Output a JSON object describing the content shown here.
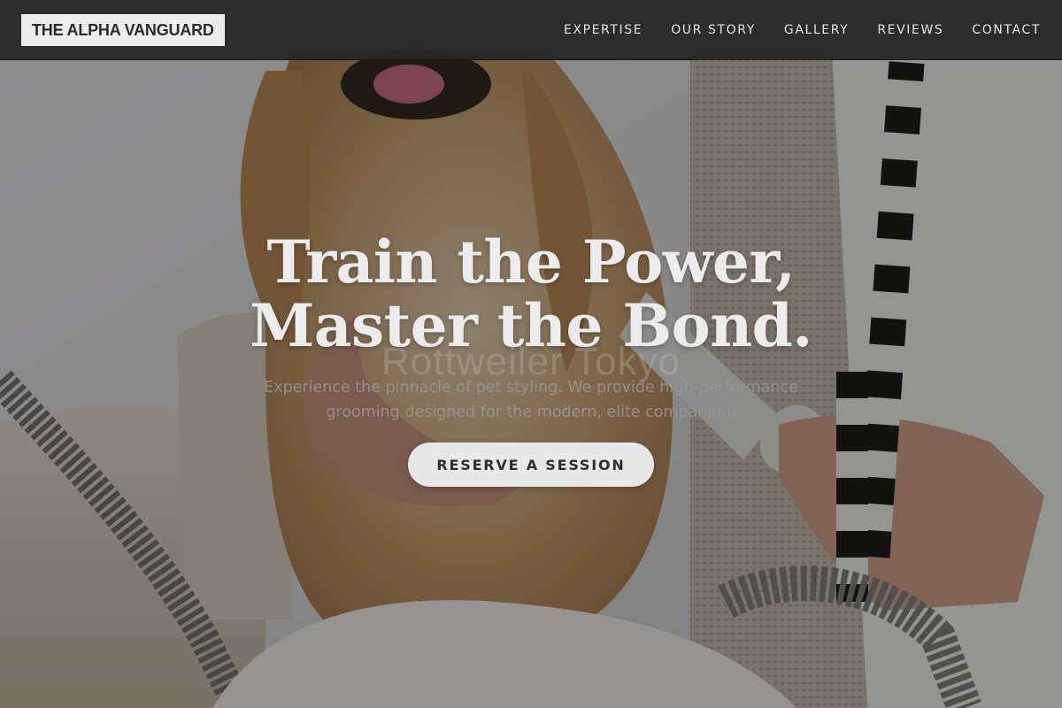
{
  "nav": {
    "brand": "THE ALPHA VANGUARD",
    "links": [
      {
        "label": "EXPERTISE"
      },
      {
        "label": "OUR STORY"
      },
      {
        "label": "GALLERY"
      },
      {
        "label": "REVIEWS"
      },
      {
        "label": "CONTACT"
      }
    ]
  },
  "hero": {
    "headline_line1": "Train the Power,",
    "headline_line2": "Master the Bond.",
    "overlay_text": "Rottweiler Tokyo",
    "subtitle": "Experience the pinnacle of pet styling. We provide high-performance grooming designed for the modern, elite companion.",
    "cta_label": "RESERVE A SESSION",
    "background_image": "photo: cocker spaniel being groomed with a vacuum grooming tool"
  },
  "colors": {
    "nav_background": "#282828",
    "brand_background": "#ececec",
    "brand_text": "#2b2b2b",
    "nav_text": "#e4e4e4",
    "headline": "#ececec",
    "cta_background": "#e8e8e8",
    "cta_text": "#2e2e2e"
  }
}
